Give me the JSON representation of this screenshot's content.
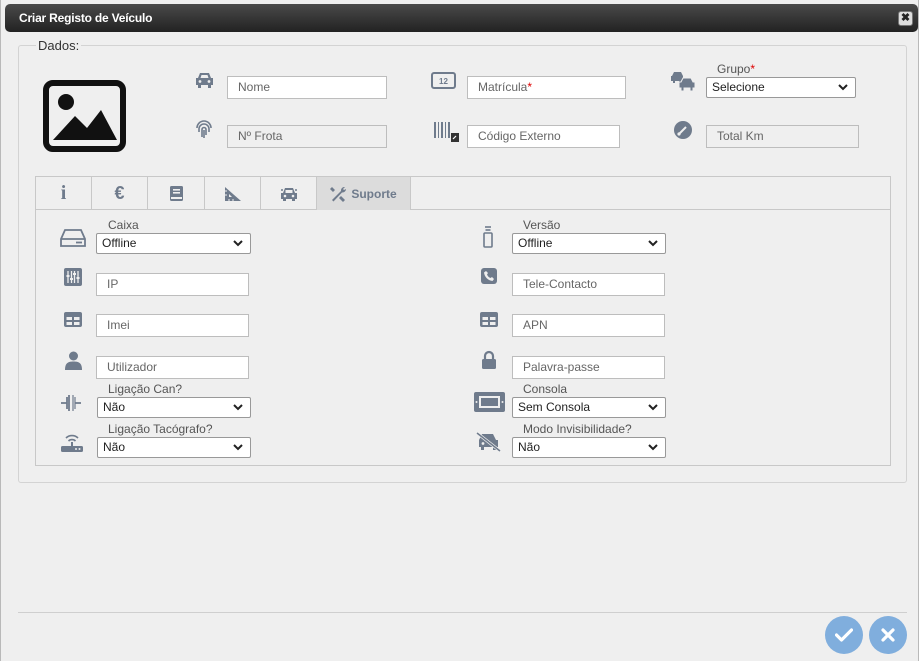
{
  "window": {
    "title": "Criar Registo de Veículo",
    "close_glyph": "✖"
  },
  "fieldset": {
    "legend": "Dados:"
  },
  "top_fields": {
    "nome": {
      "placeholder": "Nome"
    },
    "matricula": {
      "placeholder": "Matrícula",
      "required_mark": "*"
    },
    "grupo": {
      "label": "Grupo",
      "required_mark": "*",
      "selected": "Selecione"
    },
    "frota": {
      "placeholder": "Nº Frota"
    },
    "codigo_externo": {
      "placeholder": "Código Externo"
    },
    "total_km": {
      "placeholder": "Total Km"
    }
  },
  "tabs": {
    "info_glyph": "i",
    "price_glyph": "€",
    "active_label": "Suporte"
  },
  "support": {
    "caixa": {
      "label": "Caixa",
      "selected": "Offline"
    },
    "versao": {
      "label": "Versão",
      "selected": "Offline"
    },
    "ip": {
      "placeholder": "IP"
    },
    "tele_contacto": {
      "placeholder": "Tele-Contacto"
    },
    "imei": {
      "placeholder": "Imei"
    },
    "apn": {
      "placeholder": "APN"
    },
    "utilizador": {
      "placeholder": "Utilizador"
    },
    "palavra_passe": {
      "placeholder": "Palavra-passe"
    },
    "ligacao_can": {
      "label": "Ligação Can?",
      "selected": "Não"
    },
    "consola": {
      "label": "Consola",
      "selected": "Sem Consola"
    },
    "ligacao_tacografo": {
      "label": "Ligação Tacógrafo?",
      "selected": "Não"
    },
    "modo_invisibilidade": {
      "label": "Modo Invisibilidade?",
      "selected": "Não"
    }
  },
  "colors": {
    "icon": "#6f7b8c",
    "action_button": "#80aedd",
    "required": "#dd0000"
  }
}
